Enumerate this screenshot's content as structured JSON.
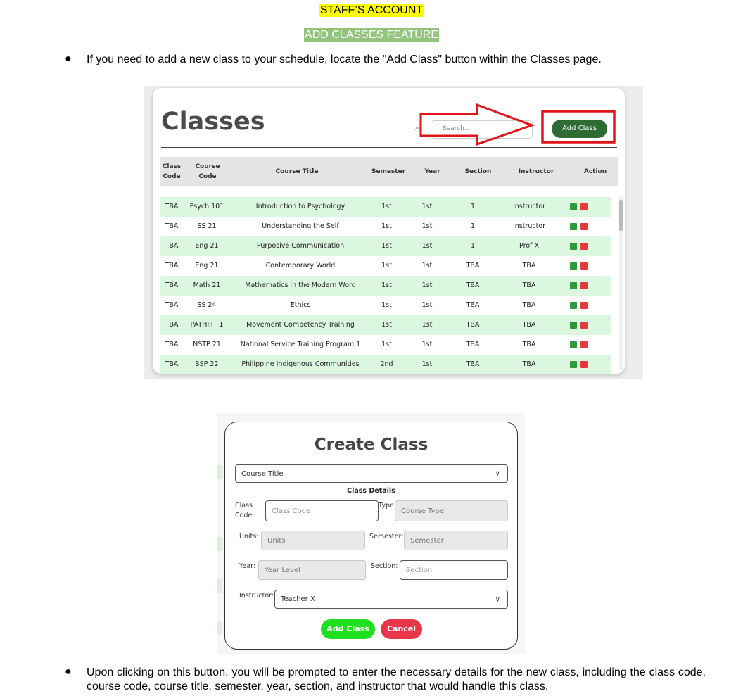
{
  "doc": {
    "heading1": "STAFF’S ACCOUNT",
    "heading2": "ADD CLASSES FEATURE",
    "bullet_char": "●",
    "bullet1": "If you need to add a new class to your schedule, locate the \"Add Class\" button within the Classes page.",
    "bullet2": "Upon clicking on this button, you will be prompted to enter the necessary details for the new class, including the class code, course code, course title, semester, year, section, and instructor that would handle this class."
  },
  "classes_page": {
    "title": "Classes",
    "search_placeholder": "Search...",
    "add_button": "Add Class",
    "columns": [
      "Class\nCode",
      "Course\nCode",
      "Course Title",
      "Semester",
      "Year",
      "Section",
      "Instructor",
      "Action"
    ],
    "rows": [
      [
        "TBA",
        "Psych 101",
        "Introduction to Psychology",
        "1st",
        "1st",
        "1",
        "Instructor"
      ],
      [
        "TBA",
        "SS 21",
        "Understanding the Self",
        "1st",
        "1st",
        "1",
        "Instructor"
      ],
      [
        "TBA",
        "Eng 21",
        "Purposive Communication",
        "1st",
        "1st",
        "1",
        "Prof X"
      ],
      [
        "TBA",
        "Eng 21",
        "Contemporary World",
        "1st",
        "1st",
        "TBA",
        "TBA"
      ],
      [
        "TBA",
        "Math 21",
        "Mathematics in the Modern Word",
        "1st",
        "1st",
        "TBA",
        "TBA"
      ],
      [
        "TBA",
        "SS 24",
        "Ethics",
        "1st",
        "1st",
        "TBA",
        "TBA"
      ],
      [
        "TBA",
        "PATHFIT 1",
        "Movement Competency Training",
        "1st",
        "1st",
        "TBA",
        "TBA"
      ],
      [
        "TBA",
        "NSTP 21",
        "National Service Training Program 1",
        "1st",
        "1st",
        "TBA",
        "TBA"
      ],
      [
        "TBA",
        "SSP 22",
        "Philippine Indigenous Communities",
        "2nd",
        "1st",
        "TBA",
        "TBA"
      ]
    ],
    "arrow_color": "#e0151b"
  },
  "create_class": {
    "title": "Create Class",
    "course_title_select": "Course Title",
    "section_heading": "Class Details",
    "class_code_label": "Class Code:",
    "class_code_placeholder": "Class Code",
    "type_label": "Type:",
    "type_value": "Course Type",
    "units_label": "Units:",
    "units_value": "Units",
    "semester_label": "Semester:",
    "semester_value": "Semester",
    "year_label": "Year:",
    "year_value": "Year Level",
    "section_label": "Section:",
    "section_placeholder": "Section",
    "instructor_label": "Instructor:",
    "instructor_value": "Teacher X",
    "add_button": "Add Class",
    "cancel_button": "Cancel",
    "add_color": "#1fe01f",
    "cancel_color": "#e8364a"
  }
}
